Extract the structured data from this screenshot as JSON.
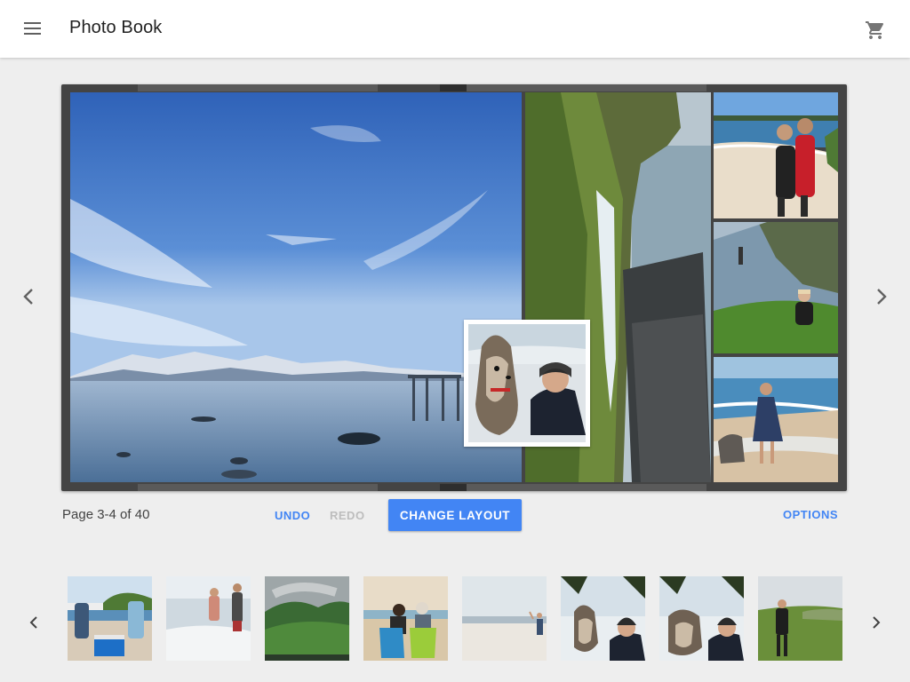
{
  "header": {
    "title": "Photo Book",
    "menu_icon": "menu-icon",
    "cart_icon": "shopping-cart-icon"
  },
  "spread": {
    "photos": [
      "lake-mountains-photo",
      "sea-cliff-waterfall-photo",
      "couple-on-beach-photo",
      "person-sitting-on-coastal-cliff-photo",
      "woman-in-dress-on-beach-with-dog-photo",
      "dog-and-woman-in-snow-photo"
    ]
  },
  "controls": {
    "page_label": "Page 3-4 of 40",
    "undo": "UNDO",
    "redo": "REDO",
    "change_layout": "CHANGE LAYOUT",
    "options": "OPTIONS"
  },
  "thumbnails": [
    "beach-picnic-thumbnail",
    "couple-walking-in-surf-thumbnail",
    "misty-forest-thumbnail",
    "couple-in-beach-chairs-thumbnail",
    "person-on-beach-thumbnail",
    "dog-and-woman-thumbnail-1",
    "dog-and-woman-thumbnail-2",
    "woman-on-grassy-hill-thumbnail"
  ],
  "colors": {
    "accent": "#4285f4",
    "disabled": "#bdbdbd",
    "background": "#eeeeee",
    "book_frame": "#444444"
  }
}
